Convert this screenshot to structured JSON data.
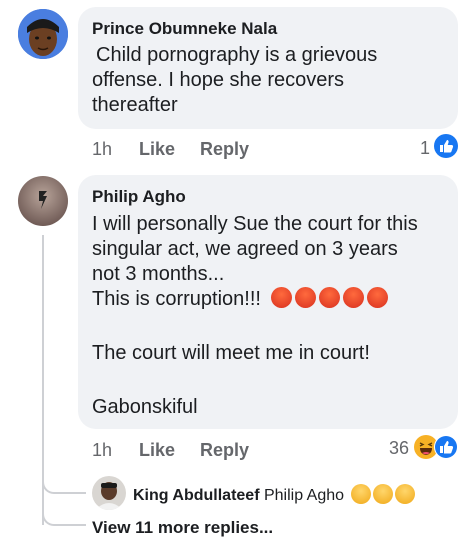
{
  "comments": [
    {
      "author": "Prince Obumneke Nala",
      "lines": [
        "Child pornography is a grievous",
        "offense. I hope she recovers",
        "thereafter"
      ],
      "time": "1h",
      "like_label": "Like",
      "reply_label": "Reply",
      "reaction_count": "1",
      "reactions": [
        "like"
      ]
    },
    {
      "author": "Philip Agho",
      "lines": [
        "I will personally Sue the court for this",
        "singular act, we agreed on 3 years",
        "not 3 months...",
        "This is corruption!!!",
        "",
        "The court will meet me in court!",
        "",
        "Gabonskiful"
      ],
      "emoji": [
        "angry",
        "angry",
        "angry",
        "angry",
        "angry"
      ],
      "time": "1h",
      "like_label": "Like",
      "reply_label": "Reply",
      "reaction_count": "36",
      "reactions": [
        "haha",
        "like"
      ]
    }
  ],
  "reply_preview": {
    "author": "King Abdullateef",
    "text": "Philip Agho",
    "emoji": [
      "eye-roll",
      "eye-roll",
      "eye-roll"
    ]
  },
  "view_more_label": "View 11 more replies...",
  "colors": {
    "like_blue": "#1877f2",
    "bubble": "#f0f2f5",
    "meta_gray": "#65676b",
    "angry_red": "#e8452c",
    "haha_yellow": "#f7b125"
  }
}
